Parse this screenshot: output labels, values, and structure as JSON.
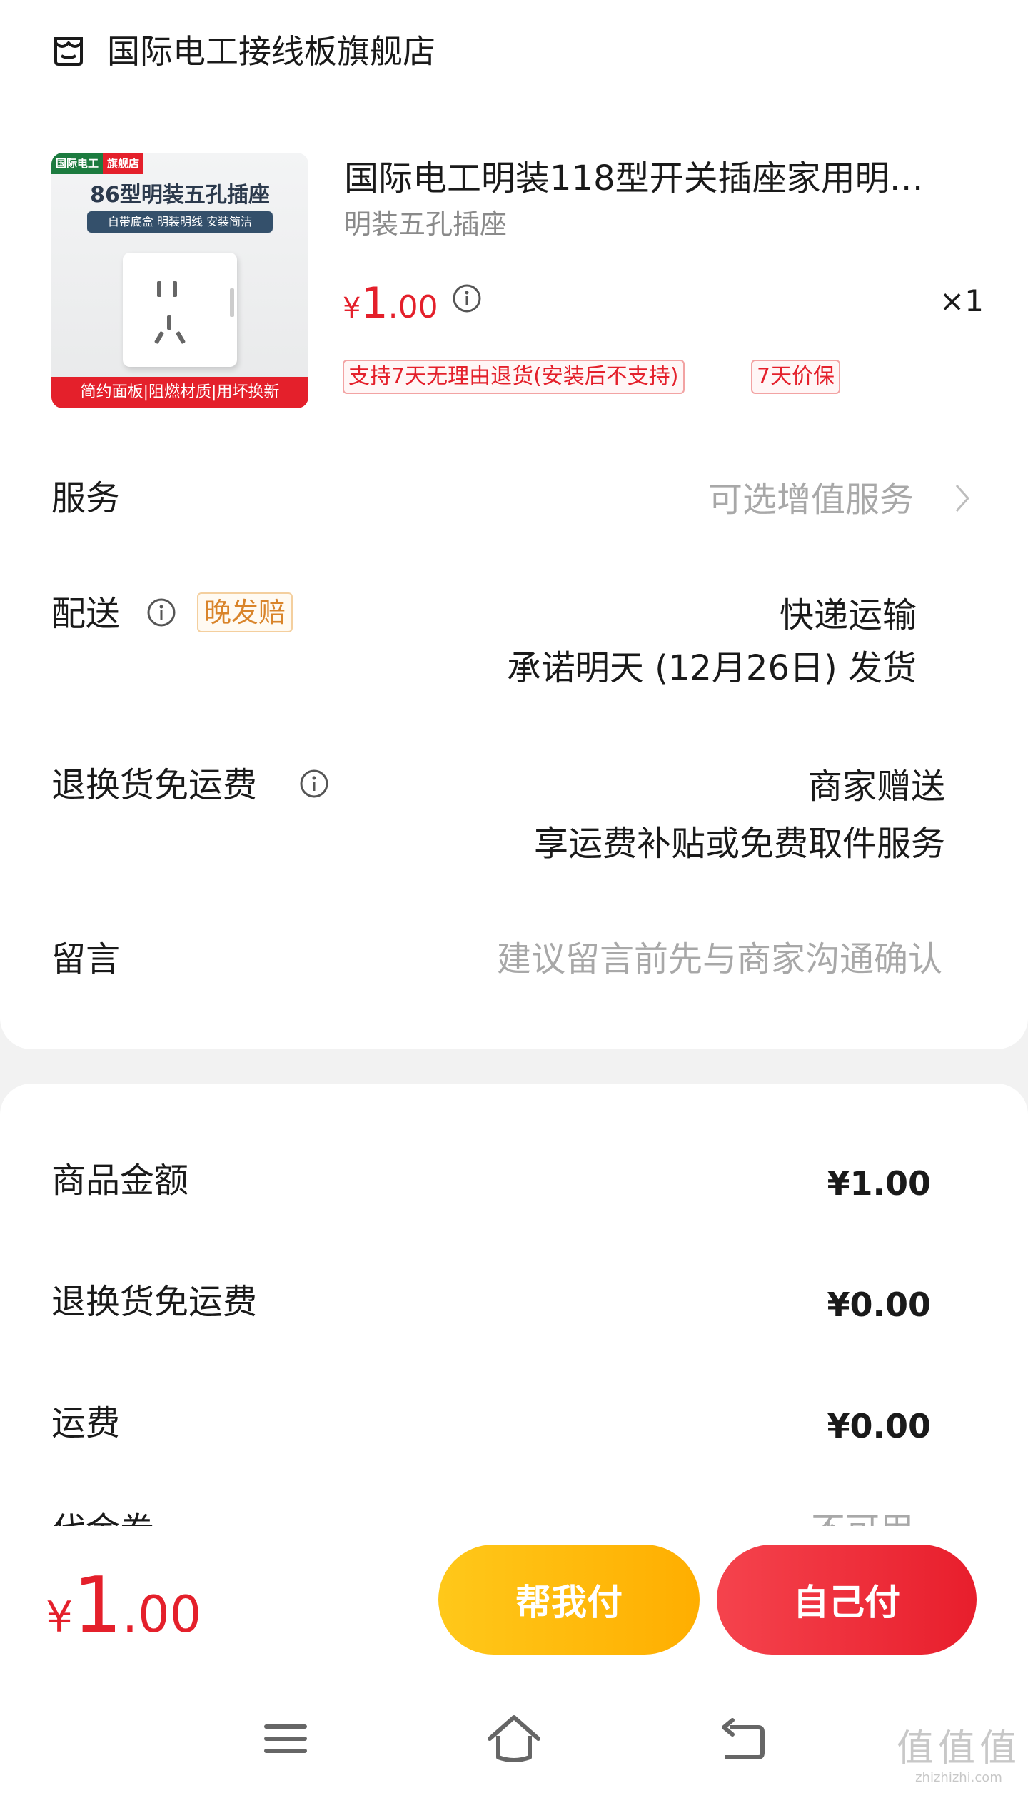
{
  "shop": {
    "name": "国际电工接线板旗舰店",
    "icon": "store-icon"
  },
  "product": {
    "title": "国际电工明装118型开关插座家用明…",
    "spec": "明装五孔插座",
    "price": {
      "currency": "¥",
      "integer": "1",
      "decimal": ".00"
    },
    "quantity": "×1",
    "tags": [
      "支持7天无理由退货(安装后不支持)",
      "7天价保"
    ],
    "image": {
      "brand": "国际电工",
      "brand_tag": "旗舰店",
      "headline": "86型明装五孔插座",
      "subline": "自带底盒 明装明线 安装简洁",
      "footer": "简约面板|阻燃材质|用坏换新"
    }
  },
  "rows": {
    "service": {
      "label": "服务",
      "value": "可选增值服务"
    },
    "delivery": {
      "label": "配送",
      "badge": "晚发赔",
      "method": "快递运输",
      "promise": "承诺明天 (12月26日) 发货"
    },
    "return_shipping": {
      "label": "退换货免运费",
      "value": "商家赠送",
      "detail": "享运费补贴或免费取件服务"
    },
    "message": {
      "label": "留言",
      "placeholder": "建议留言前先与商家沟通确认"
    }
  },
  "summary": [
    {
      "label": "商品金额",
      "value": "¥1.00"
    },
    {
      "label": "退换货免运费",
      "value": "¥0.00"
    },
    {
      "label": "运费",
      "value": "¥0.00"
    }
  ],
  "summary_partial": {
    "label": "代金券",
    "value": "不可用"
  },
  "footer": {
    "total": {
      "currency": "¥",
      "integer": "1",
      "decimal": ".00"
    },
    "help_pay_label": "帮我付",
    "self_pay_label": "自己付"
  },
  "nav": {
    "menu_icon": "menu-icon",
    "home_icon": "home-icon",
    "back_icon": "back-icon"
  },
  "watermark": {
    "glyphs": "值值值",
    "site": "zhizhizhi.com"
  },
  "colors": {
    "accent_red": "#e4202b",
    "help_pay_yellow": "#ffb800",
    "late_badge_orange": "#d9842a"
  }
}
